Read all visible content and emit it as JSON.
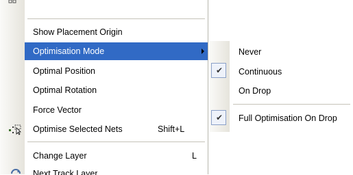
{
  "main_menu": {
    "items": [
      {
        "label": "Show Placement Origin"
      },
      {
        "label": "Optimisation Mode",
        "has_submenu": true,
        "selected": true
      },
      {
        "label": "Optimal Position"
      },
      {
        "label": "Optimal Rotation"
      },
      {
        "label": "Force Vector"
      },
      {
        "label": "Optimise Selected Nets",
        "shortcut": "Shift+L",
        "icon": "optimise-nets-icon"
      },
      {
        "label": "Change Layer",
        "shortcut": "L"
      },
      {
        "label": "Next Track Layer",
        "icon": "next-layer-icon"
      }
    ]
  },
  "submenu": {
    "items": [
      {
        "label": "Never",
        "checked": false
      },
      {
        "label": "Continuous",
        "checked": true
      },
      {
        "label": "On Drop",
        "checked": false
      },
      {
        "label": "Full Optimisation On Drop",
        "checked": true
      }
    ]
  },
  "colors": {
    "selection_bg": "#316ac5",
    "selection_fg": "#ffffff",
    "gutter": "#e6e4dc",
    "separator": "#c5c2b8"
  }
}
